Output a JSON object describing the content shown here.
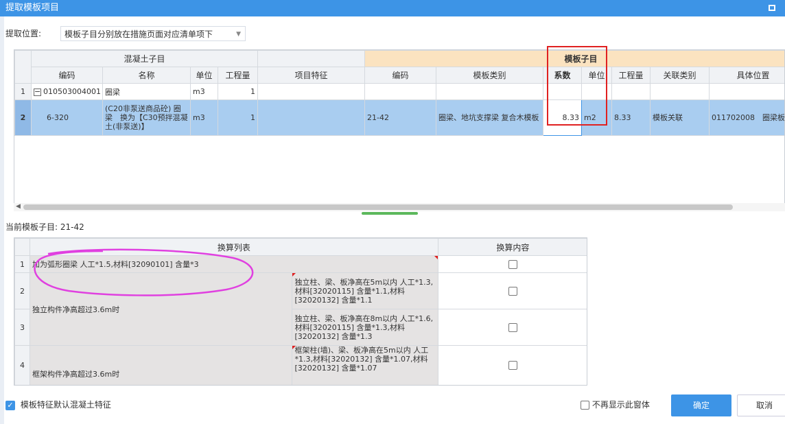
{
  "window": {
    "title": "提取模板项目"
  },
  "location": {
    "label": "提取位置:",
    "value": "模板子目分别放在措施页面对应清单项下"
  },
  "grid1": {
    "group_concrete": "混凝土子目",
    "group_formwork": "模板子目",
    "headers": {
      "code": "编码",
      "name": "名称",
      "unit": "单位",
      "qty": "工程量",
      "feature": "项目特征",
      "f_code": "编码",
      "f_type": "模板类别",
      "coef": "系数",
      "f_unit": "单位",
      "f_qty": "工程量",
      "rel_type": "关联类别",
      "position": "具体位置"
    },
    "rows": [
      {
        "rn": "1",
        "code": "010503004001",
        "name": "圈梁",
        "unit": "m3",
        "qty": "1",
        "feature": "",
        "f_code": "",
        "f_type": "",
        "coef": "",
        "f_unit": "",
        "f_qty": "",
        "rel_type": "",
        "position": ""
      },
      {
        "rn": "2",
        "code": "6-320",
        "name": "(C20非泵送商品砼) 圈梁　换为【C30预拌混凝土(非泵送)】",
        "unit": "m3",
        "qty": "1",
        "feature": "",
        "f_code": "21-42",
        "f_type": "圈梁、地坑支撑梁 复合木模板",
        "coef": "8.33",
        "f_unit": "m2",
        "f_qty": "8.33",
        "rel_type": "模板关联",
        "position": "011702008　圈梁板"
      }
    ]
  },
  "current": {
    "label": "当前模板子目:",
    "value": "21-42"
  },
  "grid2": {
    "headers": {
      "list": "换算列表",
      "content": "换算内容"
    },
    "rows": [
      {
        "rn": "1",
        "text": "加为弧形圈梁 人工*1.5,材料[32090101] 含量*3"
      },
      {
        "rn": "2",
        "group": "独立构件净高超过3.6m时",
        "detail": "独立柱、梁、板净高在5m以内 人工*1.3,材料[32020115] 含量*1.1,材料[32020132] 含量*1.1"
      },
      {
        "rn": "3",
        "detail": "独立柱、梁、板净高在8m以内 人工*1.6,材料[32020115] 含量*1.3,材料[32020132] 含量*1.3"
      },
      {
        "rn": "4",
        "group": "框架构件净高超过3.6m时",
        "detail": "框架柱(墙)、梁、板净高在5m以内 人工*1.3,材料[32020132] 含量*1.07,材料[32020132] 含量*1.07"
      }
    ]
  },
  "footer": {
    "default_feature": "模板特征默认混凝土特征",
    "no_show": "不再显示此窗体",
    "ok": "确定",
    "cancel": "取消"
  },
  "annotations": {
    "red_box": "highlight",
    "magenta_ellipse": "highlight"
  }
}
